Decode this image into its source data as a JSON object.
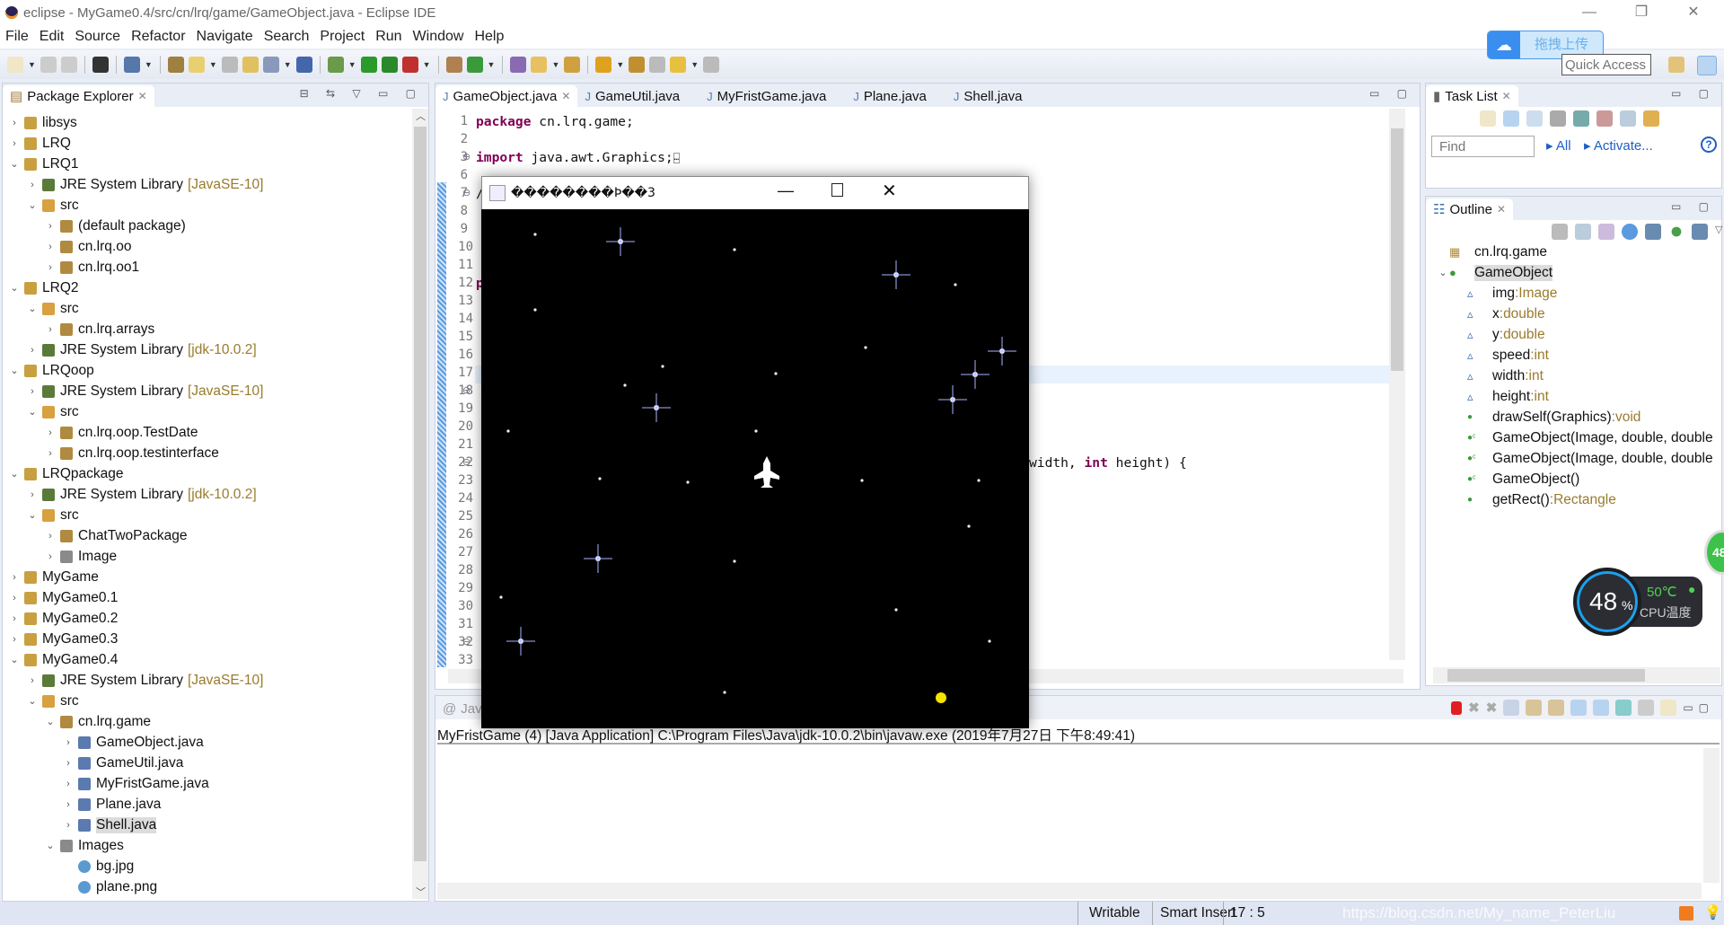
{
  "window": {
    "title": "eclipse - MyGame0.4/src/cn/lrq/game/GameObject.java - Eclipse IDE",
    "minimize": "—",
    "maximize": "❐",
    "close": "✕"
  },
  "menu": [
    "File",
    "Edit",
    "Source",
    "Refactor",
    "Navigate",
    "Search",
    "Project",
    "Run",
    "Window",
    "Help"
  ],
  "upload_widget": {
    "label": "拖拽上传"
  },
  "quick_access": {
    "placeholder": "Quick Access"
  },
  "package_explorer": {
    "title": "Package Explorer",
    "items": [
      {
        "d": 0,
        "s": "c",
        "i": "project",
        "label": "libsys"
      },
      {
        "d": 0,
        "s": "c",
        "i": "project",
        "label": "LRQ"
      },
      {
        "d": 0,
        "s": "e",
        "i": "project",
        "label": "LRQ1"
      },
      {
        "d": 1,
        "s": "c",
        "i": "library",
        "label": "JRE System Library",
        "deco": "[JavaSE-10]"
      },
      {
        "d": 1,
        "s": "e",
        "i": "src",
        "label": "src"
      },
      {
        "d": 2,
        "s": "c",
        "i": "package",
        "label": "(default package)"
      },
      {
        "d": 2,
        "s": "c",
        "i": "package",
        "label": "cn.lrq.oo"
      },
      {
        "d": 2,
        "s": "c",
        "i": "package",
        "label": "cn.lrq.oo1"
      },
      {
        "d": 0,
        "s": "e",
        "i": "project",
        "label": "LRQ2"
      },
      {
        "d": 1,
        "s": "e",
        "i": "src",
        "label": "src"
      },
      {
        "d": 2,
        "s": "c",
        "i": "package",
        "label": "cn.lrq.arrays"
      },
      {
        "d": 1,
        "s": "c",
        "i": "library",
        "label": "JRE System Library",
        "deco": "[jdk-10.0.2]"
      },
      {
        "d": 0,
        "s": "e",
        "i": "project",
        "label": "LRQoop"
      },
      {
        "d": 1,
        "s": "c",
        "i": "library",
        "label": "JRE System Library",
        "deco": "[JavaSE-10]"
      },
      {
        "d": 1,
        "s": "e",
        "i": "src",
        "label": "src"
      },
      {
        "d": 2,
        "s": "c",
        "i": "package",
        "label": "cn.lrq.oop.TestDate"
      },
      {
        "d": 2,
        "s": "c",
        "i": "package",
        "label": "cn.lrq.oop.testinterface"
      },
      {
        "d": 0,
        "s": "e",
        "i": "project",
        "label": "LRQpackage"
      },
      {
        "d": 1,
        "s": "c",
        "i": "library",
        "label": "JRE System Library",
        "deco": "[jdk-10.0.2]"
      },
      {
        "d": 1,
        "s": "e",
        "i": "src",
        "label": "src"
      },
      {
        "d": 2,
        "s": "c",
        "i": "package",
        "label": "ChatTwoPackage"
      },
      {
        "d": 2,
        "s": "c",
        "i": "folder",
        "label": "Image"
      },
      {
        "d": 0,
        "s": "c",
        "i": "project",
        "label": "MyGame"
      },
      {
        "d": 0,
        "s": "c",
        "i": "project",
        "label": "MyGame0.1"
      },
      {
        "d": 0,
        "s": "c",
        "i": "project",
        "label": "MyGame0.2"
      },
      {
        "d": 0,
        "s": "c",
        "i": "project",
        "label": "MyGame0.3"
      },
      {
        "d": 0,
        "s": "e",
        "i": "project",
        "label": "MyGame0.4"
      },
      {
        "d": 1,
        "s": "c",
        "i": "library",
        "label": "JRE System Library",
        "deco": "[JavaSE-10]"
      },
      {
        "d": 1,
        "s": "e",
        "i": "src",
        "label": "src"
      },
      {
        "d": 2,
        "s": "e",
        "i": "package",
        "label": "cn.lrq.game"
      },
      {
        "d": 3,
        "s": "c",
        "i": "java",
        "label": "GameObject.java"
      },
      {
        "d": 3,
        "s": "c",
        "i": "java",
        "label": "GameUtil.java"
      },
      {
        "d": 3,
        "s": "c",
        "i": "java",
        "label": "MyFristGame.java"
      },
      {
        "d": 3,
        "s": "c",
        "i": "java",
        "label": "Plane.java"
      },
      {
        "d": 3,
        "s": "c",
        "i": "java",
        "label": "Shell.java",
        "selected": true
      },
      {
        "d": 2,
        "s": "e",
        "i": "folder",
        "label": "Images"
      },
      {
        "d": 3,
        "s": "n",
        "i": "image",
        "label": "bg.jpg"
      },
      {
        "d": 3,
        "s": "n",
        "i": "image",
        "label": "plane.png"
      }
    ]
  },
  "editor": {
    "tabs": [
      {
        "label": "GameObject.java",
        "active": true
      },
      {
        "label": "GameUtil.java"
      },
      {
        "label": "MyFristGame.java"
      },
      {
        "label": "Plane.java"
      },
      {
        "label": "Shell.java"
      }
    ],
    "line_numbers": [
      "1",
      "2",
      "3",
      "6",
      "7",
      "8",
      "9",
      "10",
      "11",
      "12",
      "13",
      "14",
      "15",
      "16",
      "17",
      "18",
      "19",
      "20",
      "21",
      "22",
      "23",
      "24",
      "25",
      "26",
      "27",
      "28",
      "29",
      "30",
      "31",
      "32",
      "33"
    ],
    "fold_markers": {
      "3": "+",
      "7": "−",
      "18": "−",
      "22": "−",
      "32": "−"
    },
    "current_line": "17",
    "code": {
      "1": [
        {
          "t": "package",
          "kw": true
        },
        {
          "t": " cn.lrq.game;"
        }
      ],
      "3": [
        {
          "t": "import",
          "kw": true
        },
        {
          "t": " java.awt.Graphics;"
        },
        {
          "t": "…",
          "box": true
        }
      ],
      "7": [
        {
          "t": "/"
        }
      ],
      "12": [
        {
          "t": "p",
          "kw": true
        }
      ],
      "22": [
        {
          "t": "width, "
        },
        {
          "t": "int",
          "kw": true
        },
        {
          "t": " height) {"
        }
      ]
    }
  },
  "game_window": {
    "title": "��������Ϸ��3"
  },
  "console": {
    "tab": "Java",
    "launch_info": "MyFristGame (4) [Java Application] C:\\Program Files\\Java\\jdk-10.0.2\\bin\\javaw.exe (2019年7月27日 下午8:49:41)"
  },
  "task_list": {
    "title": "Task List",
    "find_placeholder": "Find",
    "all": "All",
    "activate": "Activate..."
  },
  "outline": {
    "title": "Outline",
    "items": [
      {
        "d": 0,
        "i": "package",
        "label": "cn.lrq.game"
      },
      {
        "d": 0,
        "i": "class",
        "label": "GameObject",
        "expanded": true,
        "selected": true
      },
      {
        "d": 1,
        "i": "field",
        "label": "img",
        "type": "Image"
      },
      {
        "d": 1,
        "i": "field",
        "label": "x",
        "type": "double"
      },
      {
        "d": 1,
        "i": "field",
        "label": "y",
        "type": "double"
      },
      {
        "d": 1,
        "i": "field",
        "label": "speed",
        "type": "int"
      },
      {
        "d": 1,
        "i": "field",
        "label": "width",
        "type": "int"
      },
      {
        "d": 1,
        "i": "field",
        "label": "height",
        "type": "int"
      },
      {
        "d": 1,
        "i": "method",
        "label": "drawSelf(Graphics)",
        "type": "void"
      },
      {
        "d": 1,
        "i": "constructor",
        "label": "GameObject(Image, double, double"
      },
      {
        "d": 1,
        "i": "constructor",
        "label": "GameObject(Image, double, double"
      },
      {
        "d": 1,
        "i": "constructor",
        "label": "GameObject()"
      },
      {
        "d": 1,
        "i": "method",
        "label": "getRect()",
        "type": "Rectangle"
      }
    ]
  },
  "cpu_widget": {
    "usage": "48",
    "unit": "%",
    "temp": "50℃",
    "label": "CPU温度",
    "side_badge": "48"
  },
  "status_bar": {
    "writable": "Writable",
    "insert_mode": "Smart Insert",
    "position": "17 : 5"
  },
  "watermark": "https://blog.csdn.net/My_name_PeterLiu",
  "colors": {
    "keyword": "#7f0055",
    "decoration": "#9a7b2c",
    "selection": "#dcdcdc",
    "current_line": "#e8f2fe",
    "accent": "#3d8ee6"
  }
}
